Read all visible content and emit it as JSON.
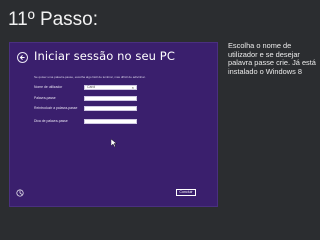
{
  "slide": {
    "title": "11º Passo:",
    "caption": "Escolha o nome de utilizador  e se desejar palavra passe crie. Já está instalado o Windows 8"
  },
  "setup": {
    "title": "Iniciar sessão no seu PC",
    "instruction": "Se quiser uma palavra-passe, escolha algo fácil de lembrar, mas difícil de adivinhar.",
    "fields": [
      {
        "label": "Nome de utilizador",
        "value": "Carol"
      },
      {
        "label": "Palavra-passe",
        "value": ""
      },
      {
        "label": "Reintroduzir a palavra-passe",
        "value": ""
      },
      {
        "label": "Dica de palavra-passe",
        "value": ""
      }
    ],
    "clear_symbol": "×",
    "next_label": "Concluir",
    "colors": {
      "background": "#3a1f6d",
      "field": "#ffffff"
    },
    "icons": [
      "back-arrow-icon",
      "mouse-cursor-icon",
      "ease-of-access-icon",
      "clear-icon"
    ]
  }
}
